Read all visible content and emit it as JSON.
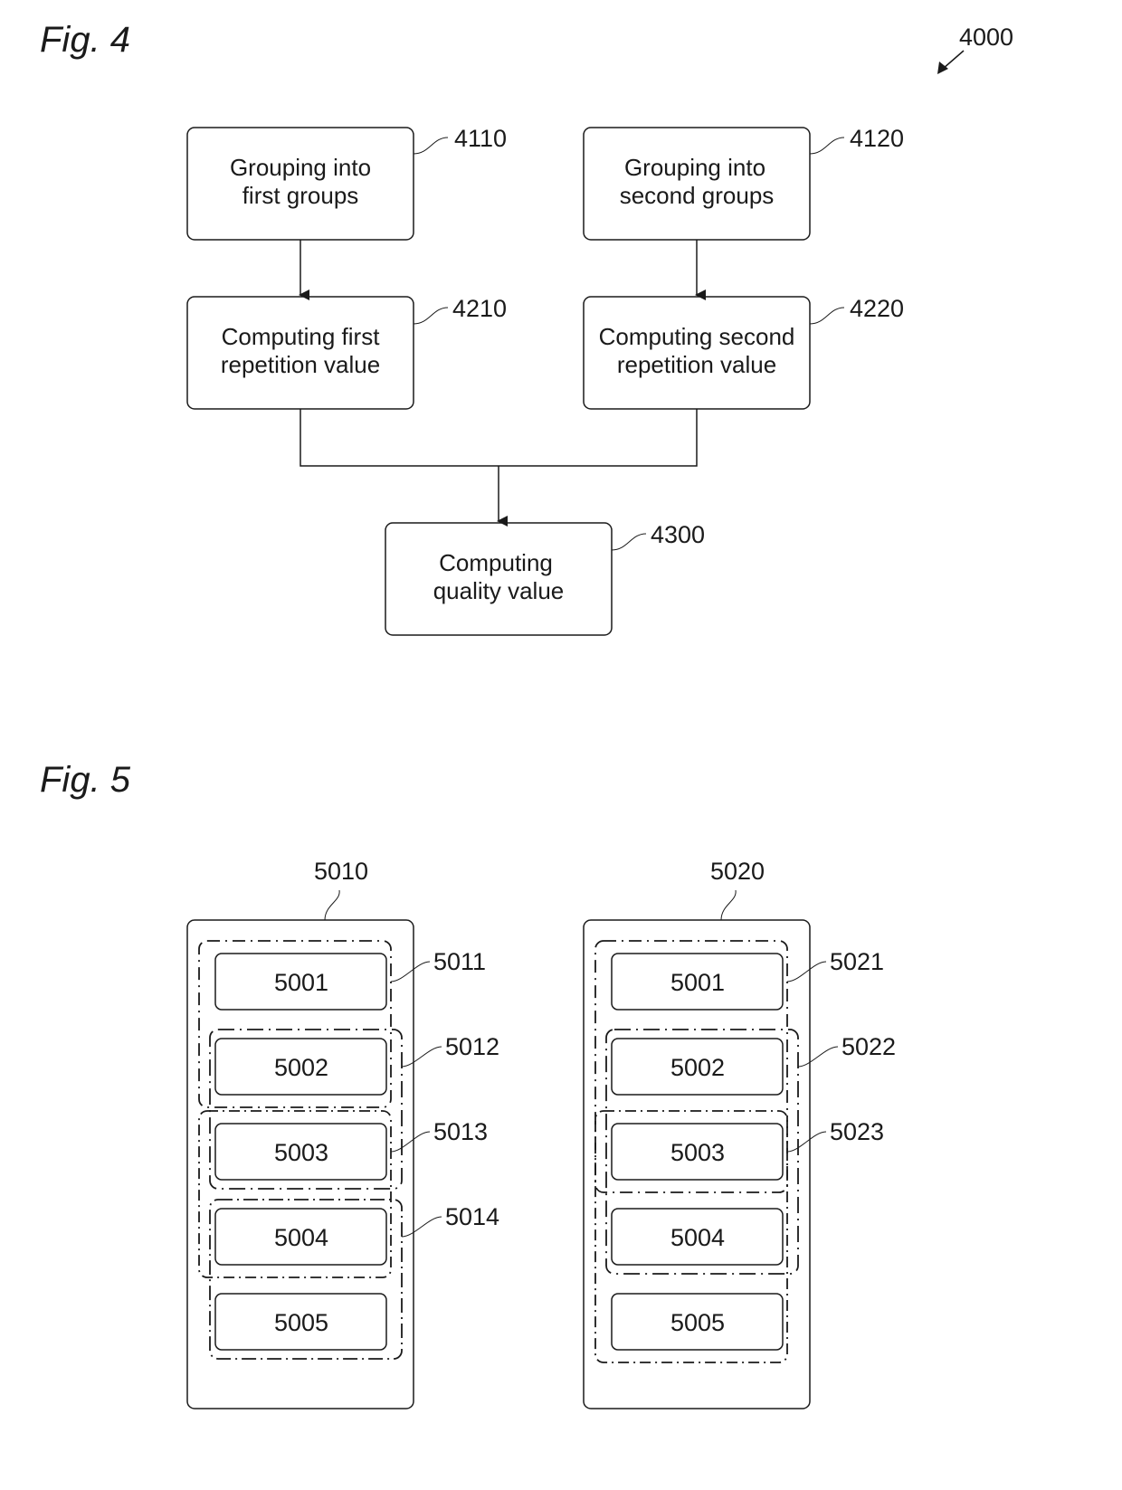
{
  "fig4": {
    "title": "Fig. 4",
    "reference": "4000",
    "steps": [
      {
        "id": "4110",
        "lines": [
          "Grouping into",
          "first groups"
        ]
      },
      {
        "id": "4120",
        "lines": [
          "Grouping into",
          "second groups"
        ]
      },
      {
        "id": "4210",
        "lines": [
          "Computing first",
          "repetition value"
        ]
      },
      {
        "id": "4220",
        "lines": [
          "Computing second",
          "repetition value"
        ]
      },
      {
        "id": "4300",
        "lines": [
          "Computing",
          "quality value"
        ]
      }
    ],
    "flows": [
      {
        "from": "4110",
        "to": "4210"
      },
      {
        "from": "4120",
        "to": "4220"
      },
      {
        "from": [
          "4210",
          "4220"
        ],
        "to": "4300"
      }
    ]
  },
  "fig5": {
    "title": "Fig. 5",
    "sets": [
      {
        "id": "5010",
        "items": [
          "5001",
          "5002",
          "5003",
          "5004",
          "5005"
        ],
        "groups": [
          {
            "id": "5011",
            "members": [
              "5001",
              "5002"
            ]
          },
          {
            "id": "5012",
            "members": [
              "5002",
              "5003"
            ]
          },
          {
            "id": "5013",
            "members": [
              "5003",
              "5004"
            ]
          },
          {
            "id": "5014",
            "members": [
              "5004",
              "5005"
            ]
          }
        ]
      },
      {
        "id": "5020",
        "items": [
          "5001",
          "5002",
          "5003",
          "5004",
          "5005"
        ],
        "groups": [
          {
            "id": "5021",
            "members": [
              "5001",
              "5002",
              "5003"
            ]
          },
          {
            "id": "5022",
            "members": [
              "5002",
              "5003",
              "5004"
            ]
          },
          {
            "id": "5023",
            "members": [
              "5003",
              "5004",
              "5005"
            ]
          }
        ]
      }
    ]
  }
}
